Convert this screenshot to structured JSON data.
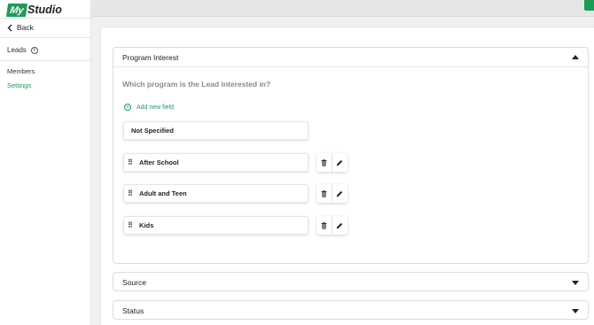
{
  "app": {
    "logo_mark": "My",
    "logo_text": "Studio"
  },
  "sidebar": {
    "back_label": "Back",
    "section_label": "Leads",
    "items": [
      {
        "label": "Members"
      },
      {
        "label": "Settings",
        "active": true
      }
    ]
  },
  "colors": {
    "accent": "#1e9b57",
    "question_text": "#8a8a8a"
  },
  "icons": [
    "chevron-left-icon",
    "info-icon",
    "caret-up-icon",
    "caret-down-icon",
    "plus-circle-icon",
    "drag-handle-icon",
    "trash-icon",
    "pencil-icon"
  ],
  "sections": {
    "program_interest": {
      "title": "Program Interest",
      "expanded": true,
      "question": "Which program is the Lead interested in?",
      "add_field_label": "Add new field",
      "default_option": "Not Specified",
      "options": [
        "After School",
        "Adult and Teen",
        "Kids"
      ]
    },
    "source": {
      "title": "Source",
      "expanded": false
    },
    "status": {
      "title": "Status",
      "expanded": false
    }
  }
}
